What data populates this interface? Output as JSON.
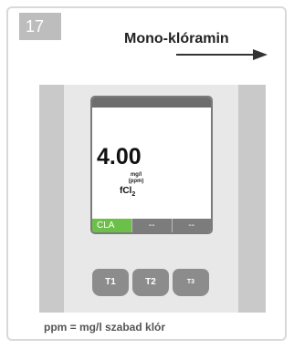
{
  "step_number": "17",
  "title": "Mono-klóramin",
  "display": {
    "reading": "4.00",
    "unit_line1": "mg/l",
    "unit_line2": "(ppm)",
    "parameter": "fCl",
    "parameter_sub": "2",
    "softkeys": [
      "CLA",
      "--",
      "--"
    ]
  },
  "keys": [
    "T1",
    "T2",
    "T3"
  ],
  "footer": "ppm = mg/l szabad klór",
  "colors": {
    "active_softkey": "#6cc04a",
    "key": "#8c8c8c",
    "step_badge": "#bdbdbd"
  },
  "icons": {
    "arrow": "arrow-right-icon"
  }
}
